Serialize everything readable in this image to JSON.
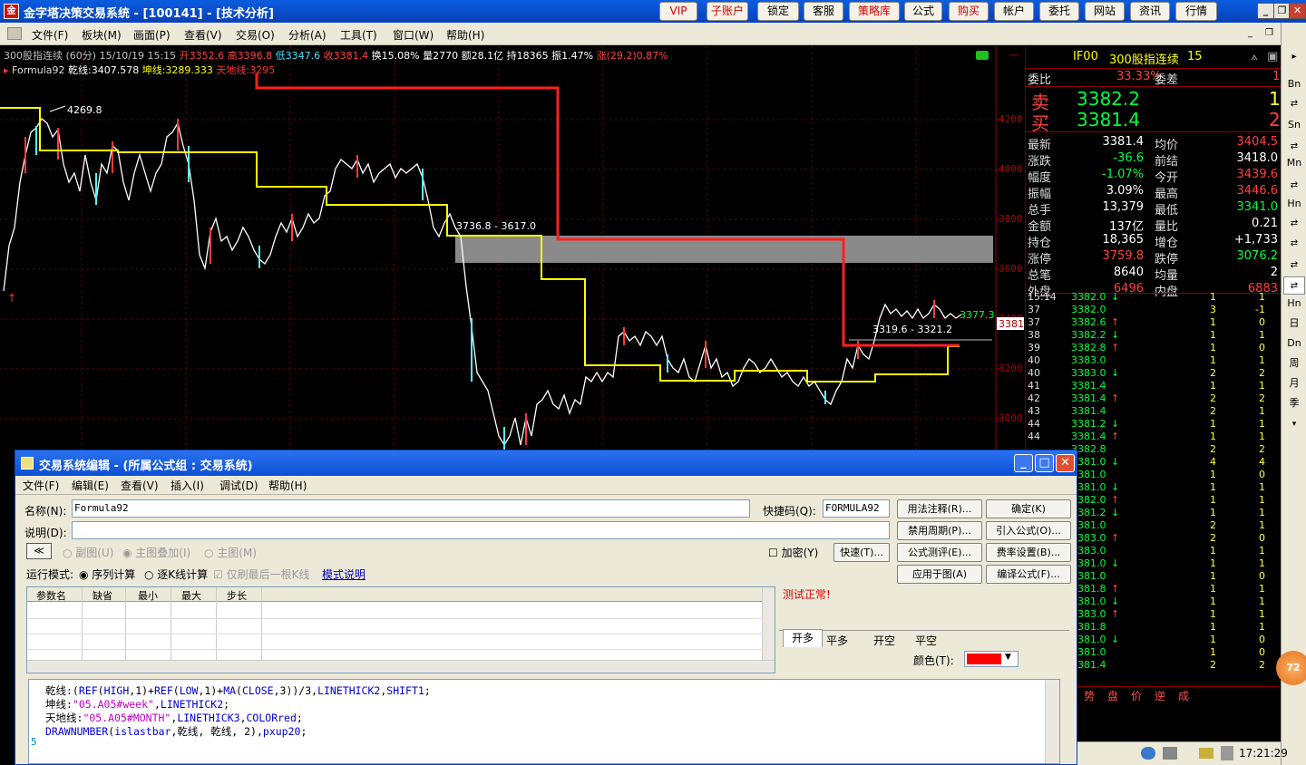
{
  "window": {
    "title": "金字塔决策交易系统 - [100141] - [技术分析]"
  },
  "toolbar": {
    "buttons": [
      "VIP",
      "子账户",
      "锁定",
      "客服",
      "策略库",
      "公式",
      "购买",
      "帐户",
      "委托",
      "网站",
      "资讯",
      "行情"
    ]
  },
  "menu": [
    "文件(F)",
    "板块(M)",
    "画面(P)",
    "查看(V)",
    "交易(O)",
    "分析(A)",
    "工具(T)",
    "窗口(W)",
    "帮助(H)"
  ],
  "chart": {
    "info1": "300股指连续 (60分) 15/10/19 15:15",
    "open": "开3352.6",
    "high": "高3396.8",
    "low": "低3347.6",
    "close": "收3381.4",
    "turnover": "换15.08%",
    "volume": "量2770",
    "amount": "额28.1亿",
    "hold": "持18365",
    "amp": "振1.47%",
    "change": "涨(29.2)0.87%",
    "formula": "Formula92",
    "qian": "乾线:3407.578",
    "kun": "坤线:3289.333",
    "tiandi": "天地线:3295",
    "annotations": [
      "4269.8",
      "3736.8 - 3617.0",
      "3319.6 - 3321.2",
      "3377.3"
    ],
    "axis_labels": [
      "4200",
      "4000",
      "3800",
      "3600",
      "3400",
      "3200",
      "3000"
    ],
    "current_price": "3381"
  },
  "quote": {
    "code": "IF00",
    "name": "300股指连续",
    "num": "15",
    "weibi_l": "委比",
    "weibi": "33.33%",
    "weicha_l": "委差",
    "weicha": "1",
    "sell_l": "卖",
    "sell": "3382.2",
    "sell_vol": "1",
    "buy_l": "买",
    "buy": "3381.4",
    "buy_vol": "2",
    "stats": [
      [
        "最新",
        "3381.4",
        "均价",
        "3404.5"
      ],
      [
        "涨跌",
        "-36.6",
        "前结",
        "3418.0"
      ],
      [
        "幅度",
        "-1.07%",
        "今开",
        "3439.6"
      ],
      [
        "振幅",
        "3.09%",
        "最高",
        "3446.6"
      ],
      [
        "总手",
        "13,379",
        "最低",
        "3341.0"
      ],
      [
        "金额",
        "137亿",
        "量比",
        "0.21"
      ],
      [
        "持仓",
        "18,365",
        "增仓",
        "+1,733"
      ],
      [
        "涨停",
        "3759.8",
        "跌停",
        "3076.2"
      ],
      [
        "总笔",
        "8640",
        "均量",
        "2"
      ],
      [
        "外盘",
        "6496",
        "内盘",
        "6883"
      ]
    ],
    "ticks": [
      [
        "15:14",
        "3382.0",
        "↓",
        "1",
        "1"
      ],
      [
        "37",
        "3382.0",
        "",
        "3",
        "-1"
      ],
      [
        "37",
        "3382.6",
        "↑",
        "1",
        "0"
      ],
      [
        "38",
        "3382.2",
        "↓",
        "1",
        "1"
      ],
      [
        "39",
        "3382.8",
        "↑",
        "1",
        "0"
      ],
      [
        "40",
        "3383.0",
        "",
        "1",
        "1"
      ],
      [
        "40",
        "3383.0",
        "↓",
        "2",
        "2"
      ],
      [
        "41",
        "3381.4",
        "",
        "1",
        "1"
      ],
      [
        "42",
        "3381.4",
        "↑",
        "2",
        "2"
      ],
      [
        "43",
        "3381.4",
        "",
        "2",
        "1"
      ],
      [
        "44",
        "3381.2",
        "↓",
        "1",
        "1"
      ],
      [
        "44",
        "3381.4",
        "↑",
        "1",
        "1"
      ],
      [
        "",
        "3382.8",
        "",
        "2",
        "2"
      ],
      [
        "",
        "3381.0",
        "↓",
        "4",
        "4"
      ],
      [
        "",
        "3381.0",
        "",
        "1",
        "0"
      ],
      [
        "",
        "3381.0",
        "↓",
        "1",
        "1"
      ],
      [
        "",
        "3382.0",
        "↑",
        "1",
        "1"
      ],
      [
        "",
        "3381.2",
        "↓",
        "1",
        "1"
      ],
      [
        "",
        "3381.0",
        "",
        "2",
        "1"
      ],
      [
        "",
        "3383.0",
        "↑",
        "2",
        "0"
      ],
      [
        "",
        "3383.0",
        "",
        "1",
        "1"
      ],
      [
        "",
        "3381.0",
        "↓",
        "1",
        "1"
      ],
      [
        "",
        "3381.0",
        "",
        "1",
        "0"
      ],
      [
        "",
        "3381.8",
        "↑",
        "1",
        "1"
      ],
      [
        "",
        "3381.0",
        "↓",
        "1",
        "1"
      ],
      [
        "",
        "3383.0",
        "↑",
        "1",
        "1"
      ],
      [
        "",
        "3381.8",
        "",
        "1",
        "1"
      ],
      [
        "",
        "3381.0",
        "↓",
        "1",
        "0"
      ],
      [
        "",
        "3381.0",
        "",
        "1",
        "0"
      ],
      [
        "",
        "3381.4",
        "",
        "2",
        "2"
      ]
    ],
    "bottom_tabs": [
      "势",
      "盘",
      "价",
      "逆",
      "成"
    ]
  },
  "side_tabs": [
    "Bn",
    "Sn",
    "Mn",
    "Hn",
    "日",
    "Dn",
    "周",
    "月",
    "季"
  ],
  "dialog": {
    "title": "交易系统编辑 - (所属公式组 : 交易系统)",
    "menu": [
      "文件(F)",
      "编辑(E)",
      "查看(V)",
      "插入(I)",
      "调试(D)",
      "帮助(H)"
    ],
    "name_label": "名称(N):",
    "name_value": "Formula92",
    "shortcut_label": "快捷码(Q):",
    "shortcut_value": "FORMULA92",
    "desc_label": "说明(D):",
    "desc_value": "",
    "chart_opts": [
      "副图(U)",
      "主图叠加(I)",
      "主图(M)"
    ],
    "encrypt": "加密(Y)",
    "quick": "快速(T)...",
    "run_mode_label": "运行模式:",
    "run_modes": [
      "序列计算",
      "逐K线计算"
    ],
    "refresh_last": "仅刷最后一根K线",
    "mode_help": "模式说明",
    "param_cols": [
      "参数名",
      "缺省",
      "最小",
      "最大",
      "步长"
    ],
    "buttons": [
      "用法注释(R)...",
      "确定(K)",
      "禁用周期(P)...",
      "引入公式(O)...",
      "公式测评(E)...",
      "费率设置(B)...",
      "应用于图(A)",
      "编译公式(F)..."
    ],
    "status": "测试正常!",
    "tabs": [
      "开多",
      "平多",
      "开空",
      "平空"
    ],
    "color_label": "颜色(T):",
    "color_value": "#ff0000",
    "code_lines": [
      "乾线:(REF(HIGH,1)+REF(LOW,1)+MA(CLOSE,3))/3,LINETHICK2,SHIFT1;",
      "坤线:\"05.A05#week\",LINETHICK2;",
      "天地线:\"05.A05#MONTH\",LINETHICK3,COLORred;",
      "DRAWNUMBER(islastbar,乾线, 乾线, 2),pxup20;"
    ],
    "line_num": "5"
  },
  "status": {
    "time": "17:21:29",
    "badge": "72"
  }
}
